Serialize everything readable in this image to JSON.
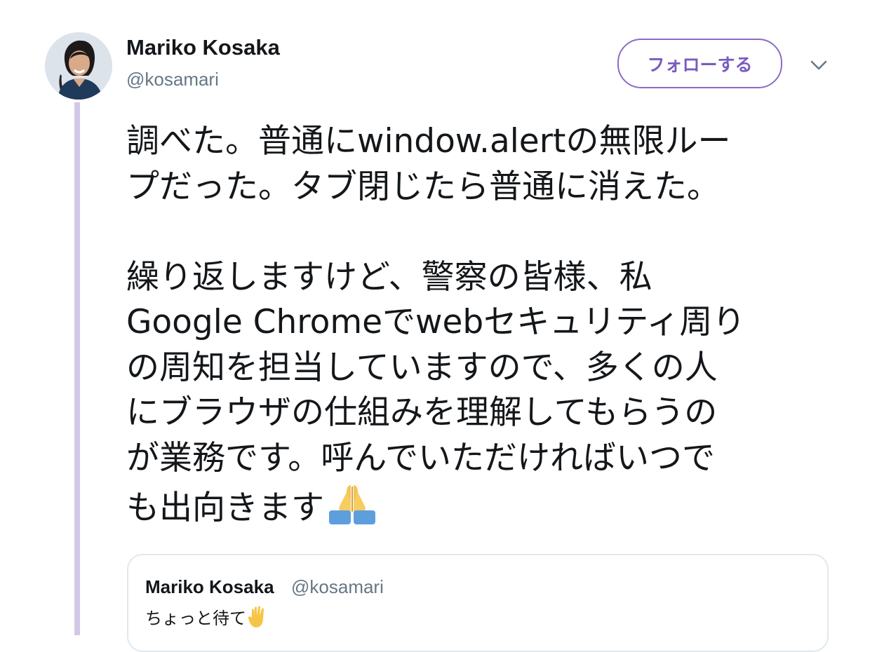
{
  "tweet": {
    "author": {
      "name": "Mariko Kosaka",
      "handle": "@kosamari",
      "avatar_icon": "user-avatar"
    },
    "follow_label": "フォローする",
    "menu_icon": "chevron-down-icon",
    "lines": [
      "調べた。普通にwindow.alertの無限ルー",
      "プだった。タブ閉じたら普通に消えた。",
      "",
      "繰り返しますけど、警察の皆様、私",
      "Google Chromeでwebセキュリティ周り",
      "の周知を担当していますので、多くの人",
      "にブラウザの仕組みを理解してもらうの",
      "が業務です。呼んでいただければいつで",
      "も出向きます"
    ],
    "emoji_trailing": "folded-hands-emoji"
  },
  "quoted_tweet": {
    "name": "Mariko Kosaka",
    "handle": "@kosamari",
    "text": "ちょっと待て",
    "emoji": "raised-hand-emoji"
  },
  "colors": {
    "accent": "#7a5bbf",
    "thread_line": "#d2c8e6",
    "secondary_text": "#657786",
    "border": "#e1e8ed"
  }
}
